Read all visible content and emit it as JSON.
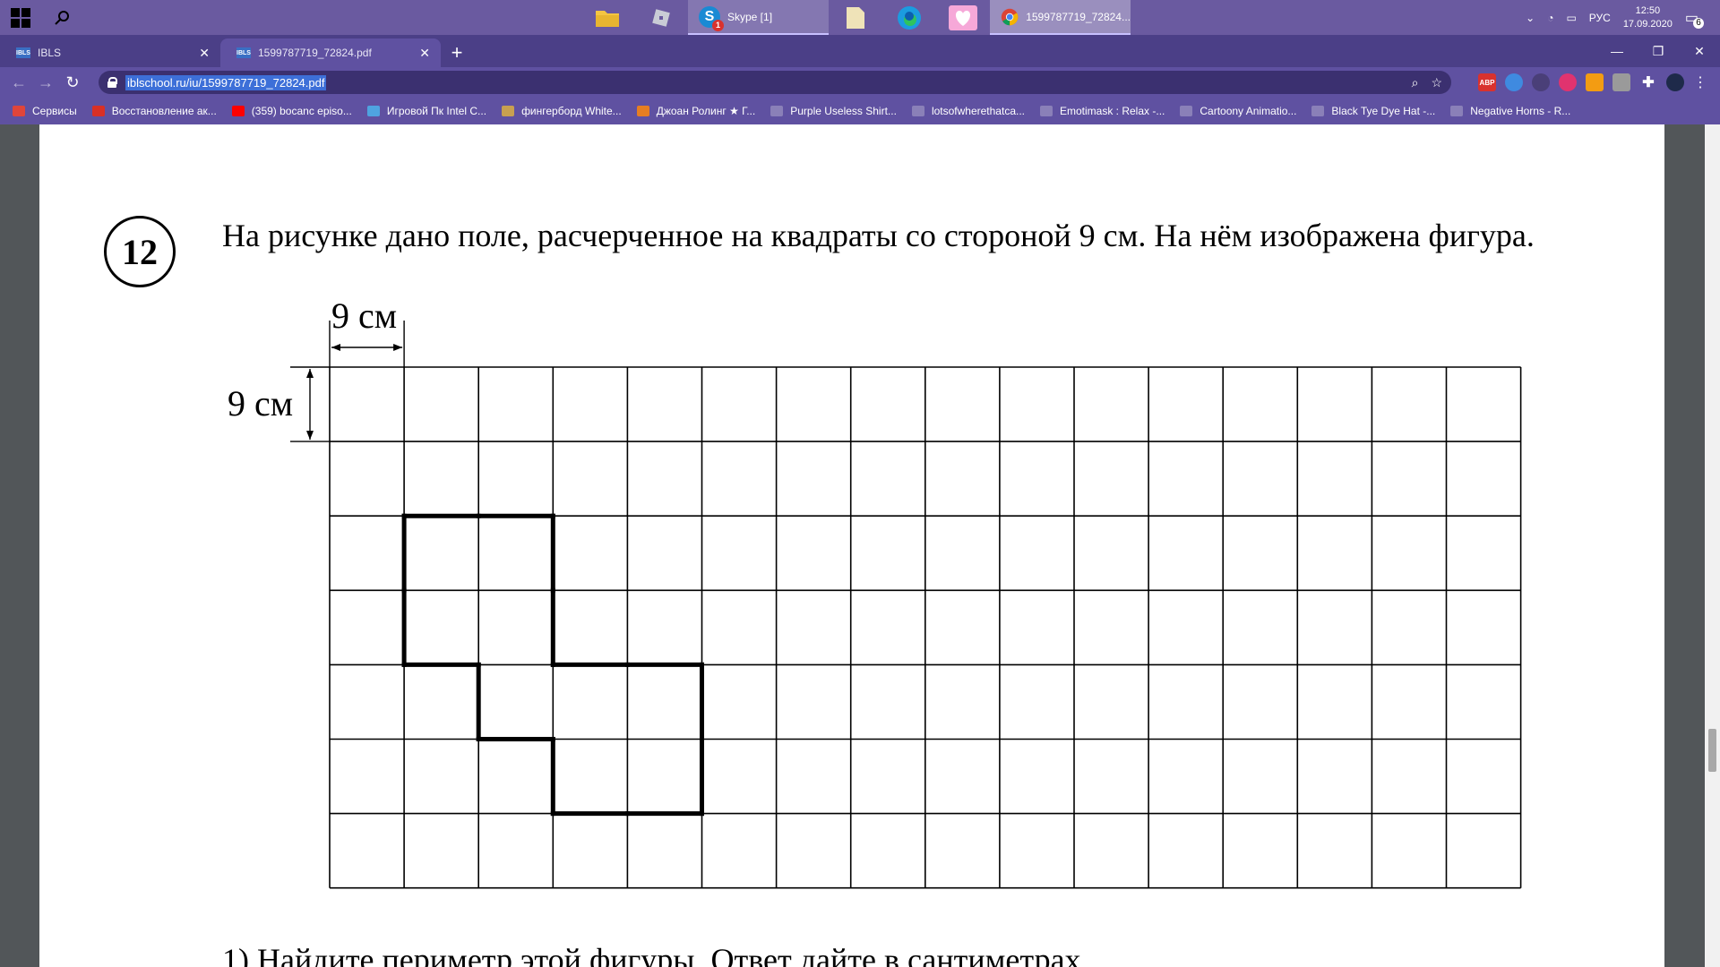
{
  "taskbar": {
    "skype_label": "Skype [1]",
    "skype_badge": "1",
    "chrome_label": "1599787719_72824...",
    "lang": "РУС",
    "time": "12:50",
    "date": "17.09.2020",
    "notif_count": "6"
  },
  "tabs": [
    {
      "fav": "IBLS",
      "title": "IBLS"
    },
    {
      "fav": "IBLS",
      "title": "1599787719_72824.pdf"
    }
  ],
  "toolbar": {
    "url": "iblschool.ru/iu/1599787719_72824.pdf"
  },
  "bookmarks": [
    {
      "label": "Сервисы",
      "color": "#e0453a"
    },
    {
      "label": "Восстановление ак...",
      "color": "#d93025"
    },
    {
      "label": "(359) bocanc episo...",
      "color": "#ff0000"
    },
    {
      "label": "Игровой Пк Intel C...",
      "color": "#4fa3e0"
    },
    {
      "label": "фингерборд White...",
      "color": "#c8a050"
    },
    {
      "label": "Джоан Ролинг ★ Г...",
      "color": "#e67e22"
    },
    {
      "label": "Purple Useless Shirt...",
      "color": "#8a80b8"
    },
    {
      "label": "lotsofwherethatca...",
      "color": "#8a80b8"
    },
    {
      "label": "Emotimask : Relax -...",
      "color": "#8a80b8"
    },
    {
      "label": "Cartoony Animatio...",
      "color": "#8a80b8"
    },
    {
      "label": "Black Tye Dye Hat -...",
      "color": "#8a80b8"
    },
    {
      "label": "Negative Horns - R...",
      "color": "#8a80b8"
    }
  ],
  "document": {
    "question_number": "12",
    "question_text": "На рисунке дано поле, расчерченное на квадраты со стороной 9 см. На нём изображена фигура.",
    "dim_horizontal": "9 см",
    "dim_vertical": "9 см",
    "sub_question": "1) Найдите периметр этой фигуры. Ответ дайте в сантиметрах.",
    "grid": {
      "columns": 16,
      "rows": 7,
      "figure_cells": [
        [
          1,
          2
        ],
        [
          2,
          2
        ],
        [
          1,
          3
        ],
        [
          2,
          3
        ],
        [
          2,
          4
        ],
        [
          3,
          4
        ],
        [
          4,
          4
        ],
        [
          3,
          5
        ],
        [
          4,
          5
        ]
      ]
    }
  }
}
